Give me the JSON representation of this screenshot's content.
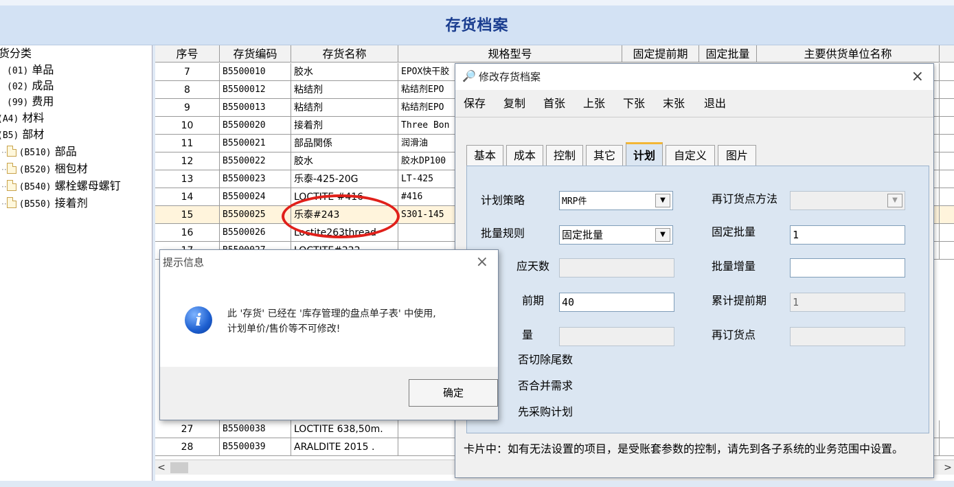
{
  "page": {
    "title": "存货档案"
  },
  "tree": {
    "header": "货分类",
    "items": [
      {
        "code": "(01)",
        "label": "单品"
      },
      {
        "code": "(02)",
        "label": "成品"
      },
      {
        "code": "(99)",
        "label": "费用"
      },
      {
        "code": "(A4)",
        "label": "材料"
      },
      {
        "code": "(B5)",
        "label": "部材"
      },
      {
        "code": "(B510)",
        "label": "部品"
      },
      {
        "code": "(B520)",
        "label": "梱包材"
      },
      {
        "code": "(B540)",
        "label": "螺栓螺母螺钉"
      },
      {
        "code": "(B550)",
        "label": "接着剂"
      }
    ]
  },
  "grid": {
    "headers": [
      "序号",
      "存货编码",
      "存货名称",
      "规格型号",
      "固定提前期",
      "固定批量",
      "主要供货单位名称"
    ],
    "rows": [
      [
        "7",
        "B5500010",
        "胶水",
        "EPOX快干胶"
      ],
      [
        "8",
        "B5500012",
        "粘结剂",
        "粘结剂EPO"
      ],
      [
        "9",
        "B5500013",
        "粘结剂",
        "粘结剂EPO"
      ],
      [
        "10",
        "B5500020",
        "接着剂",
        "Three Bon"
      ],
      [
        "11",
        "B5500021",
        "部品関係",
        "润滑油"
      ],
      [
        "12",
        "B5500022",
        "胶水",
        "胶水DP100"
      ],
      [
        "13",
        "B5500023",
        "乐泰-425-20G",
        "LT-425"
      ],
      [
        "14",
        "B5500024",
        "LOCTITE  #416",
        "#416"
      ],
      [
        "15",
        "B5500025",
        "乐泰#243",
        "S301-145"
      ],
      [
        "16",
        "B5500026",
        "Loctite263thread",
        ""
      ],
      [
        "17",
        "B5500027",
        "LOCTITE#222",
        ""
      ],
      [
        "27",
        "B5500038",
        "LOCTITE  638,50m.",
        ""
      ],
      [
        "28",
        "B5500039",
        "ARALDITE  2015  .",
        ""
      ]
    ],
    "scroll_left": "<",
    "scroll_right": ">"
  },
  "edit_dialog": {
    "title": "修改存货档案",
    "close": "×",
    "toolbar": [
      "保存",
      "复制",
      "首张",
      "上张",
      "下张",
      "末张",
      "退出"
    ],
    "tabs": [
      "基本",
      "成本",
      "控制",
      "其它",
      "计划",
      "自定义",
      "图片"
    ],
    "active_tab": "计划",
    "fields": {
      "plan_strategy_label": "计划策略",
      "plan_strategy_value": "MRP件",
      "reorder_method_label": "再订货点方法",
      "reorder_method_value": "",
      "batch_rule_label": "批量规则",
      "batch_rule_value": "固定批量",
      "fixed_batch_label": "固定批量",
      "fixed_batch_value": "1",
      "supply_days_label": "应天数",
      "supply_days_value": "",
      "batch_increment_label": "批量增量",
      "batch_increment_value": "",
      "lead_time_label": "前期",
      "lead_time_value": "40",
      "cum_lead_label": "累计提前期",
      "cum_lead_value": "1",
      "qty_label": "量",
      "qty_value": "",
      "reorder_point_label": "再订货点",
      "reorder_point_value": "",
      "cut_tail_label": "否切除尾数",
      "merge_demand_label": "否合并需求",
      "purchase_plan_label": "先采购计划"
    },
    "note": "卡片中：如有无法设置的项目，是受账套参数的控制，请先到各子系统的业务范围中设置。"
  },
  "message_box": {
    "title": "提示信息",
    "close": "×",
    "line1": "此 '存货' 已经在 '库存管理的盘点单子表' 中使用,",
    "line2": "计划单价/售价等不可修改!",
    "ok": "确定"
  },
  "colors": {
    "title_blue": "#1a3d8f",
    "highlight": "#e0201a",
    "tab_accent": "#f2b636"
  }
}
